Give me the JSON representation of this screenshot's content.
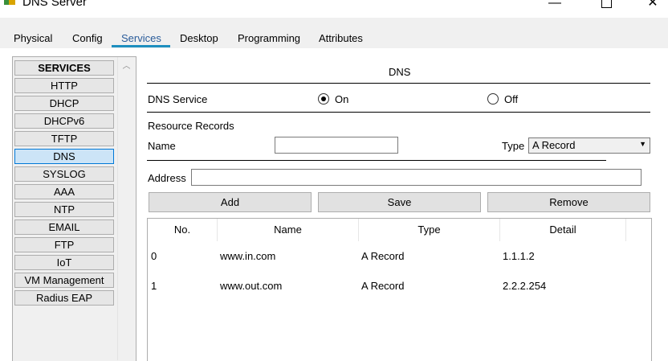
{
  "window": {
    "title": "DNS Server",
    "minimize": "—",
    "close": "✕"
  },
  "tabs": [
    "Physical",
    "Config",
    "Services",
    "Desktop",
    "Programming",
    "Attributes"
  ],
  "active_tab": "Services",
  "services": {
    "header": "SERVICES",
    "items": [
      "HTTP",
      "DHCP",
      "DHCPv6",
      "TFTP",
      "DNS",
      "SYSLOG",
      "AAA",
      "NTP",
      "EMAIL",
      "FTP",
      "IoT",
      "VM Management",
      "Radius EAP"
    ],
    "selected": "DNS"
  },
  "dns": {
    "section_title": "DNS",
    "service_label": "DNS Service",
    "on_label": "On",
    "off_label": "Off",
    "service_state": "On",
    "resource_records_label": "Resource Records",
    "name_label": "Name",
    "name_value": "",
    "type_label": "Type",
    "type_value": "A Record",
    "address_label": "Address",
    "address_value": "",
    "add_button": "Add",
    "save_button": "Save",
    "remove_button": "Remove"
  },
  "records_table": {
    "columns": [
      "No.",
      "Name",
      "Type",
      "Detail"
    ],
    "rows": [
      [
        "0",
        "www.in.com",
        "A Record",
        "1.1.1.2"
      ],
      [
        "1",
        "www.out.com",
        "A Record",
        "2.2.2.254"
      ]
    ]
  }
}
